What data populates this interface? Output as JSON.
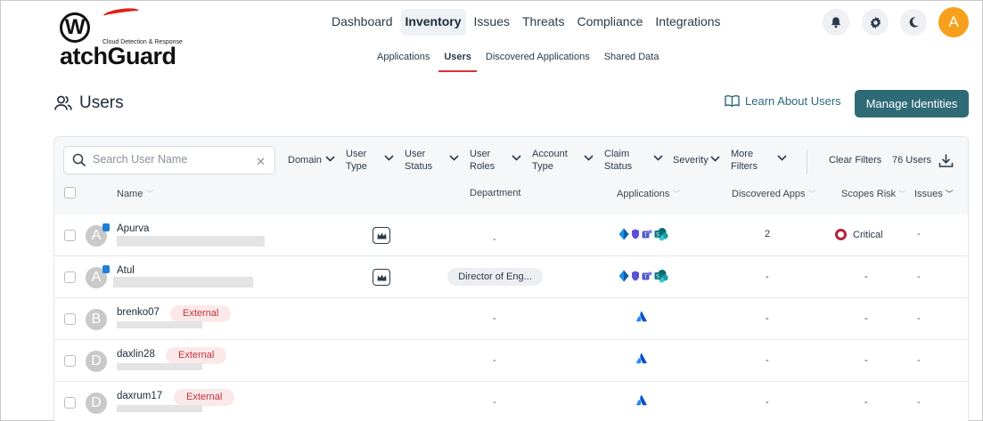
{
  "brand": {
    "logo_text": "WatchGuard",
    "logo_subtitle": "Cloud Detection & Response"
  },
  "nav": {
    "items": [
      {
        "label": "Dashboard",
        "active": false
      },
      {
        "label": "Inventory",
        "active": true
      },
      {
        "label": "Issues",
        "active": false
      },
      {
        "label": "Threats",
        "active": false
      },
      {
        "label": "Compliance",
        "active": false
      },
      {
        "label": "Integrations",
        "active": false
      }
    ]
  },
  "topbar": {
    "icons": [
      "bell-icon",
      "gear-icon",
      "moon-icon"
    ],
    "avatar_initial": "A"
  },
  "subnav": {
    "items": [
      {
        "label": "Applications",
        "active": false
      },
      {
        "label": "Users",
        "active": true
      },
      {
        "label": "Discovered Applications",
        "active": false
      },
      {
        "label": "Shared Data",
        "active": false
      }
    ]
  },
  "page": {
    "title": "Users",
    "learn_link": "Learn About Users",
    "manage_button": "Manage Identities"
  },
  "toolbar": {
    "search_placeholder": "Search User Name",
    "filters": [
      {
        "line1": "Domain",
        "line2": ""
      },
      {
        "line1": "User",
        "line2": "Type"
      },
      {
        "line1": "User",
        "line2": "Status"
      },
      {
        "line1": "User",
        "line2": "Roles"
      },
      {
        "line1": "Account",
        "line2": "Type"
      },
      {
        "line1": "Claim",
        "line2": "Status"
      },
      {
        "line1": "Severity",
        "line2": ""
      },
      {
        "line1": "More",
        "line2": "Filters"
      }
    ],
    "clear_filters": "Clear Filters",
    "user_count": "76 Users"
  },
  "table": {
    "columns": {
      "name": "Name",
      "department": "Department",
      "applications": "Applications",
      "discovered_apps": "Discovered Apps",
      "scopes_risk": "Scopes Risk",
      "issues": "Issues"
    },
    "rows": [
      {
        "initial": "A",
        "name": "Apurva",
        "external": "",
        "admin": true,
        "department": "-",
        "apps": "microsoft",
        "discovered": "2",
        "risk": "Critical",
        "issues": "-"
      },
      {
        "initial": "A",
        "name": "Atul",
        "external": "",
        "admin": true,
        "department": "Director of Eng...",
        "apps": "microsoft",
        "discovered": "-",
        "risk": "-",
        "issues": "-"
      },
      {
        "initial": "B",
        "name": "brenko07",
        "external": "External",
        "admin": false,
        "department": "-",
        "apps": "atlassian",
        "discovered": "-",
        "risk": "-",
        "issues": "-"
      },
      {
        "initial": "D",
        "name": "daxlin28",
        "external": "External",
        "admin": false,
        "department": "-",
        "apps": "atlassian",
        "discovered": "-",
        "risk": "-",
        "issues": "-"
      },
      {
        "initial": "D",
        "name": "daxrum17",
        "external": "External",
        "admin": false,
        "department": "-",
        "apps": "atlassian",
        "discovered": "-",
        "risk": "-",
        "issues": "-"
      }
    ]
  },
  "colors": {
    "accent": "#2f6b77",
    "active_underline": "#d9313a",
    "avatar": "#f7a01d",
    "critical": "#b3223a",
    "external_badge_bg": "#fbe9ea",
    "external_badge_text": "#c0323a"
  }
}
